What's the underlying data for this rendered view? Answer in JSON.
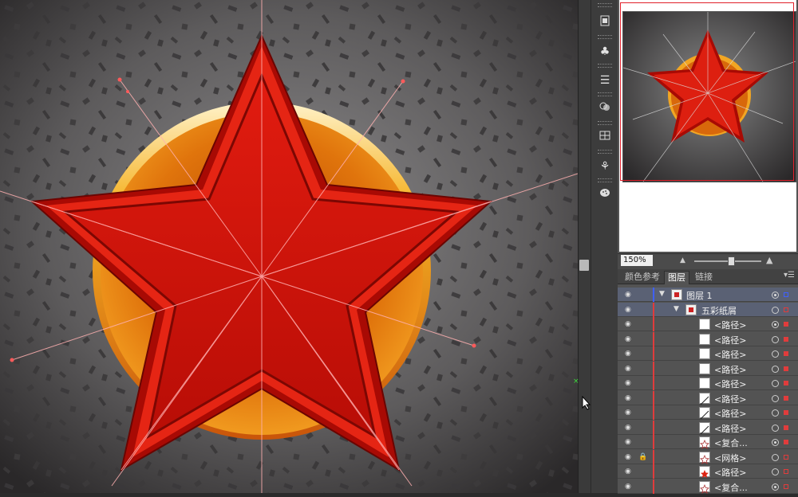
{
  "navigator": {
    "zoom_value": "150%"
  },
  "tabs": [
    {
      "label": "颜色参考"
    },
    {
      "label": "图层"
    },
    {
      "label": "链接"
    }
  ],
  "layers": [
    {
      "name": "图层 1",
      "level": 0,
      "expanded": true,
      "locked": false
    },
    {
      "name": "五彩纸屑",
      "level": 1,
      "expanded": true,
      "locked": false
    },
    {
      "name": "<路径>",
      "level": 2,
      "locked": false
    },
    {
      "name": "<路径>",
      "level": 2,
      "locked": false
    },
    {
      "name": "<路径>",
      "level": 2,
      "locked": false
    },
    {
      "name": "<路径>",
      "level": 2,
      "locked": false
    },
    {
      "name": "<路径>",
      "level": 2,
      "locked": false
    },
    {
      "name": "<路径>",
      "level": 2,
      "locked": false
    },
    {
      "name": "<路径>",
      "level": 2,
      "locked": false
    },
    {
      "name": "<路径>",
      "level": 2,
      "locked": false
    },
    {
      "name": "<复合...",
      "level": 2,
      "locked": false
    },
    {
      "name": "<网格>",
      "level": 2,
      "locked": true
    },
    {
      "name": "<路径>",
      "level": 2,
      "locked": false
    },
    {
      "name": "<复合...",
      "level": 2,
      "locked": false
    }
  ],
  "tool_icons": [
    "panel-icon",
    "club-icon",
    "lines-icon",
    "circles-icon",
    "grid-icon",
    "symbol-icon",
    "palette-icon"
  ],
  "colors": {
    "star_red": "#d9150c",
    "layer_color": "#e03c3c",
    "panel_bg": "#535353"
  }
}
